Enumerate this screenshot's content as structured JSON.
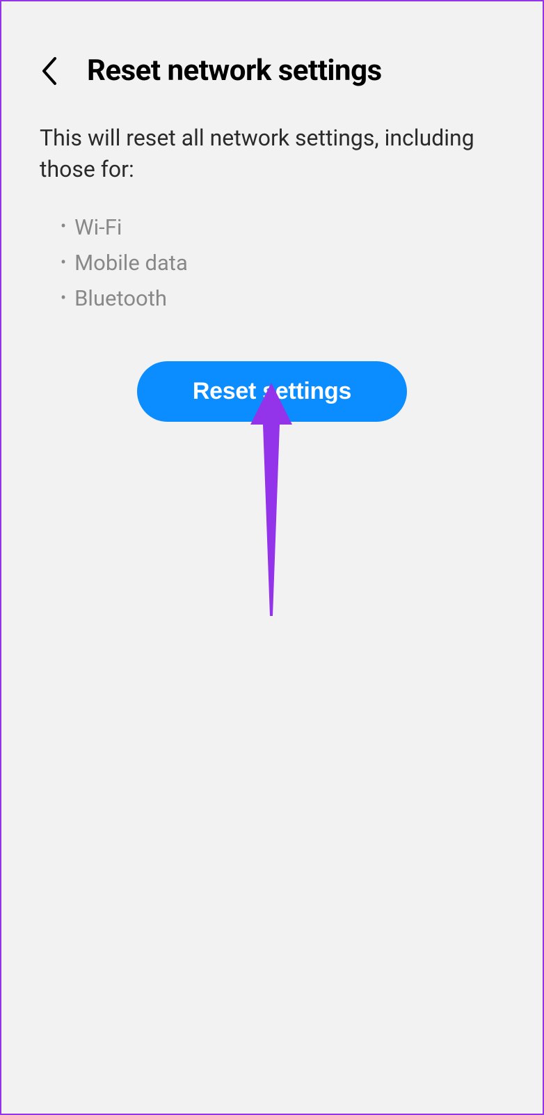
{
  "header": {
    "title": "Reset network settings"
  },
  "description": "This will reset all network settings, including those for:",
  "bullets": {
    "item0": "Wi-Fi",
    "item1": "Mobile data",
    "item2": "Bluetooth"
  },
  "button": {
    "reset_label": "Reset settings"
  }
}
